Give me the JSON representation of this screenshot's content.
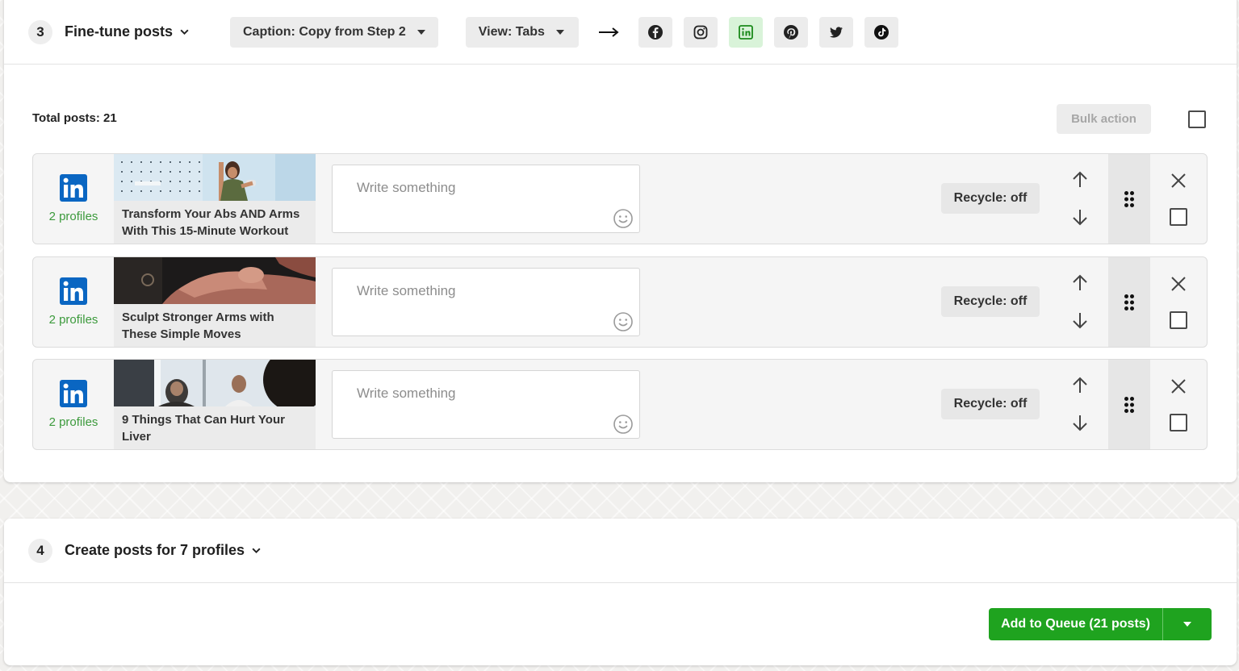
{
  "step3": {
    "number": "3",
    "title": "Fine-tune posts",
    "caption_dropdown": "Caption: Copy from Step 2",
    "view_dropdown": "View: Tabs",
    "networks": [
      {
        "name": "facebook",
        "active": false
      },
      {
        "name": "instagram",
        "active": false
      },
      {
        "name": "linkedin",
        "active": true
      },
      {
        "name": "pinterest",
        "active": false
      },
      {
        "name": "twitter",
        "active": false
      },
      {
        "name": "tiktok",
        "active": false
      }
    ],
    "total_posts": "Total posts: 21",
    "bulk_action": "Bulk action",
    "posts": [
      {
        "network": "linkedin",
        "profiles": "2 profiles",
        "title": "Transform Your Abs AND Arms With This 15-Minute Workout",
        "caption_placeholder": "Write something",
        "recycle": "Recycle: off"
      },
      {
        "network": "linkedin",
        "profiles": "2 profiles",
        "title": "Sculpt Stronger Arms with These Simple Moves",
        "caption_placeholder": "Write something",
        "recycle": "Recycle: off"
      },
      {
        "network": "linkedin",
        "profiles": "2 profiles",
        "title": "9 Things That Can Hurt Your Liver",
        "caption_placeholder": "Write something",
        "recycle": "Recycle: off"
      }
    ]
  },
  "step4": {
    "number": "4",
    "title": "Create posts for 7 profiles",
    "add_to_queue": "Add to Queue (21 posts)"
  },
  "colors": {
    "accent_green": "#1fa31f",
    "linkedin_blue": "#0a66c2",
    "profiles_green": "#3c9a3c"
  }
}
